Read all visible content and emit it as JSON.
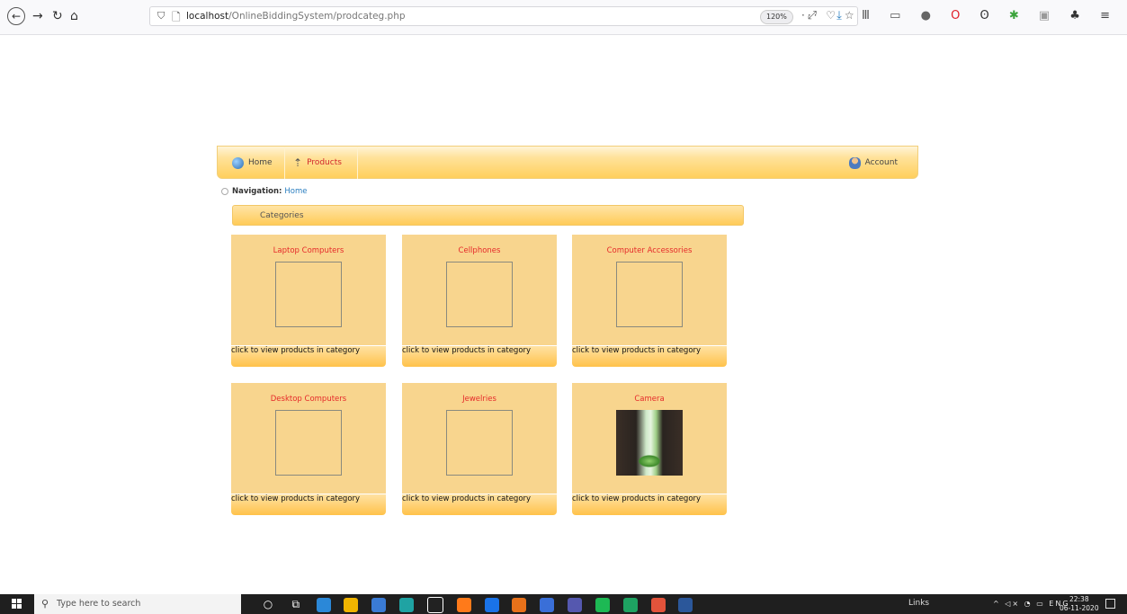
{
  "browser": {
    "url_host": "localhost",
    "url_path": "/OnlineBiddingSystem/prodcateg.php",
    "zoom": "120%"
  },
  "nav": {
    "home": "Home",
    "products": "Products",
    "account": "Account"
  },
  "breadcrumb": {
    "label": "Navigation:",
    "link": "Home"
  },
  "categories_header": "Categories",
  "categories": [
    {
      "title": "Laptop Computers",
      "caption": "click to view products in category",
      "has_photo": false
    },
    {
      "title": "Cellphones",
      "caption": "click to view products in category",
      "has_photo": false
    },
    {
      "title": "Computer Accessories",
      "caption": "click to view products in category",
      "has_photo": false
    },
    {
      "title": "Desktop Computers",
      "caption": "click to view products in category",
      "has_photo": false
    },
    {
      "title": "Jewelries",
      "caption": "click to view products in category",
      "has_photo": false
    },
    {
      "title": "Camera",
      "caption": "click to view products in category",
      "has_photo": true
    }
  ],
  "taskbar": {
    "search_placeholder": "Type here to search",
    "links_label": "Links",
    "language": "ENG",
    "time": "22:38",
    "date": "06-11-2020"
  },
  "colors": {
    "accent_red": "#e52a2a",
    "card_bg": "#f8d58e",
    "nav_gradient_end": "#ffcf5c",
    "link_blue": "#2a7ec0"
  }
}
